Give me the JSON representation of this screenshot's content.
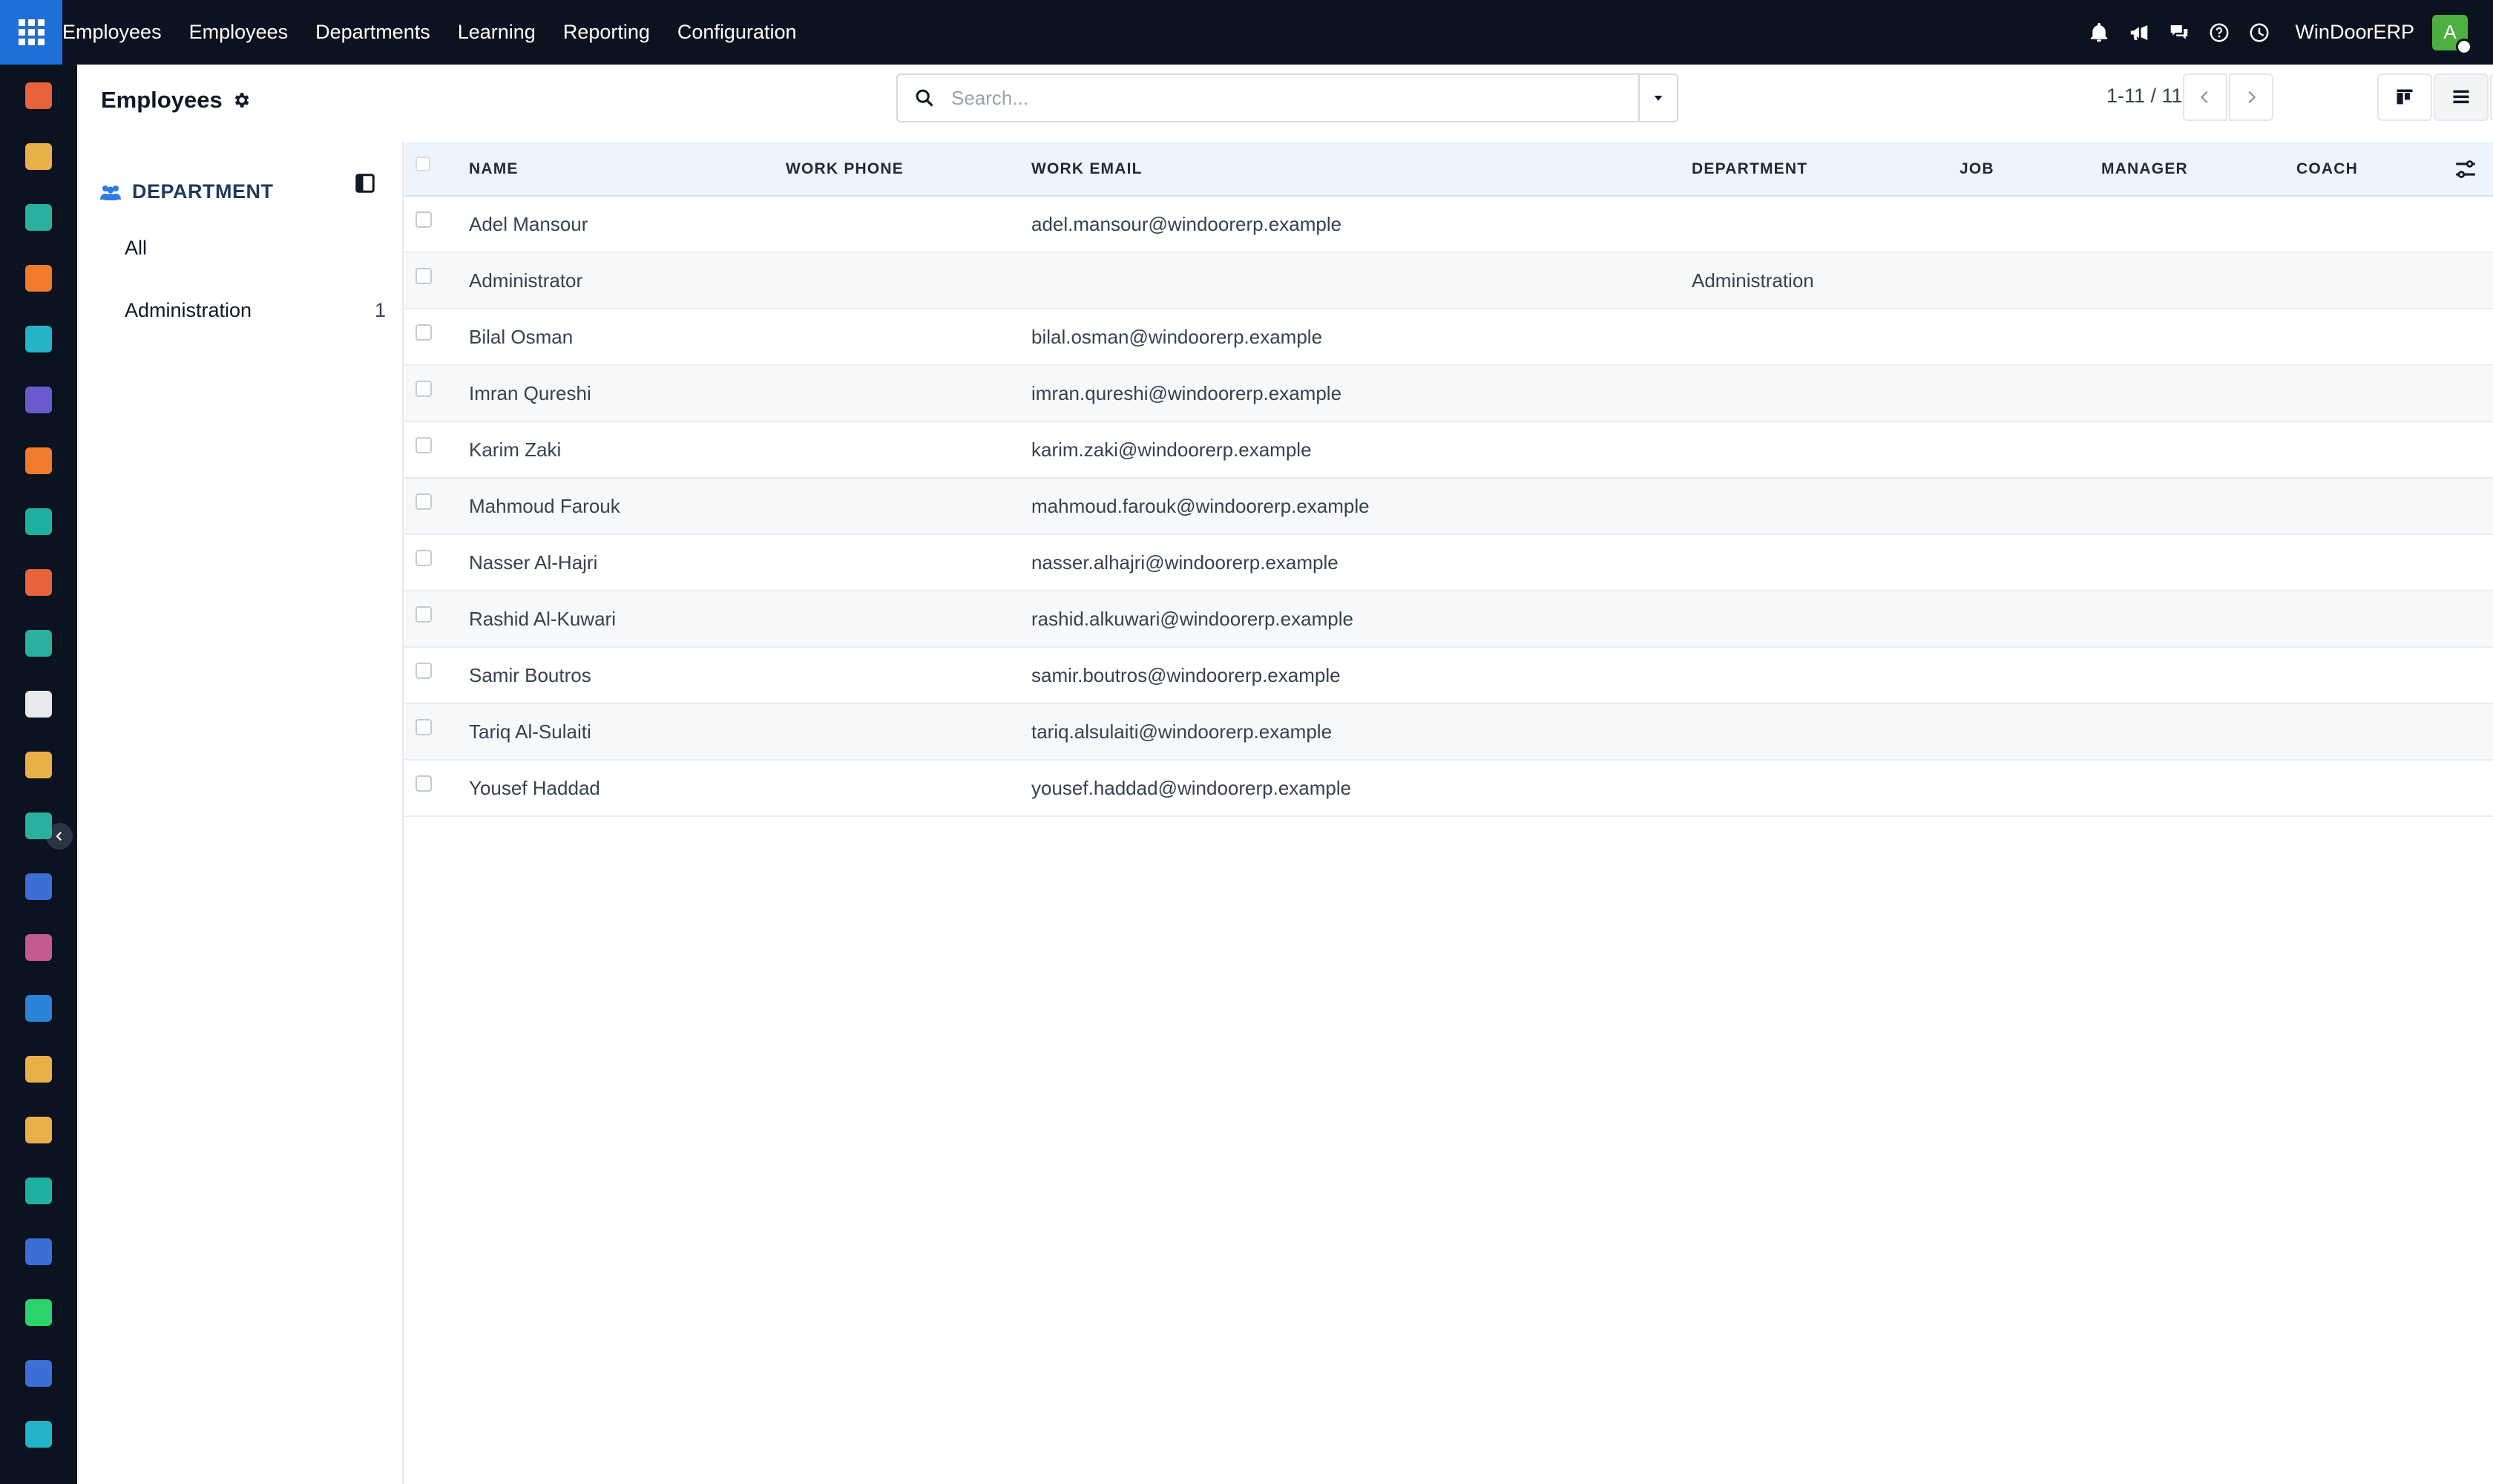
{
  "navbar": {
    "brand": "Employees",
    "menu": [
      "Employees",
      "Departments",
      "Learning",
      "Reporting",
      "Configuration"
    ],
    "company": "WinDoorERP",
    "avatar_letter": "A",
    "icons": [
      "bell-icon",
      "megaphone-icon",
      "chat-icon",
      "help-icon",
      "clock-icon"
    ]
  },
  "dock": {
    "apps": [
      {
        "name": "dashboards-app-icon",
        "color": "#e8623a"
      },
      {
        "name": "documents-app-icon",
        "color": "#e9b04a"
      },
      {
        "name": "contacts-app-icon",
        "color": "#2bb0a0"
      },
      {
        "name": "discuss-app-icon",
        "color": "#f07b2a"
      },
      {
        "name": "planning-app-icon",
        "color": "#22b5c8"
      },
      {
        "name": "mail-app-icon",
        "color": "#6a5acd"
      },
      {
        "name": "livechat-app-icon",
        "color": "#f07b2a"
      },
      {
        "name": "project-app-icon",
        "color": "#1fb1a0"
      },
      {
        "name": "reporting-app-icon",
        "color": "#e8623a"
      },
      {
        "name": "employees-app-icon",
        "color": "#2bb0a0"
      },
      {
        "name": "inventory-app-icon",
        "color": "#e7e9ee"
      },
      {
        "name": "sign-app-icon",
        "color": "#e9b04a"
      },
      {
        "name": "todo-app-icon",
        "color": "#2bb0a0"
      },
      {
        "name": "knowledge-app-icon",
        "color": "#3b6fd6"
      },
      {
        "name": "products-app-icon",
        "color": "#c45a8f"
      },
      {
        "name": "expenses-app-icon",
        "color": "#2b82d6"
      },
      {
        "name": "team-app-icon",
        "color": "#e9b04a"
      },
      {
        "name": "calendar-app-icon",
        "color": "#e9b04a"
      },
      {
        "name": "signature-app-icon",
        "color": "#1fb1a0"
      },
      {
        "name": "apps-dashboard-icon",
        "color": "#3b6fd6"
      },
      {
        "name": "whatsapp-app-icon",
        "color": "#2bd46b"
      },
      {
        "name": "timer-app-icon",
        "color": "#3b6fd6"
      },
      {
        "name": "website-app-icon",
        "color": "#22b5c8"
      }
    ]
  },
  "control": {
    "title": "Employees",
    "search_placeholder": "Search...",
    "pager": "1-11 / 11"
  },
  "searchpanel": {
    "header": "DEPARTMENT",
    "items": [
      {
        "label": "All",
        "count": ""
      },
      {
        "label": "Administration",
        "count": "1"
      }
    ]
  },
  "table": {
    "columns": [
      "NAME",
      "WORK PHONE",
      "WORK EMAIL",
      "DEPARTMENT",
      "JOB",
      "MANAGER",
      "COACH"
    ],
    "rows": [
      {
        "name": "Adel Mansour",
        "phone": "",
        "email": "adel.mansour@windoorerp.example",
        "department": ""
      },
      {
        "name": "Administrator",
        "phone": "",
        "email": "",
        "department": "Administration"
      },
      {
        "name": "Bilal Osman",
        "phone": "",
        "email": "bilal.osman@windoorerp.example",
        "department": ""
      },
      {
        "name": "Imran Qureshi",
        "phone": "",
        "email": "imran.qureshi@windoorerp.example",
        "department": ""
      },
      {
        "name": "Karim Zaki",
        "phone": "",
        "email": "karim.zaki@windoorerp.example",
        "department": ""
      },
      {
        "name": "Mahmoud Farouk",
        "phone": "",
        "email": "mahmoud.farouk@windoorerp.example",
        "department": ""
      },
      {
        "name": "Nasser Al-Hajri",
        "phone": "",
        "email": "nasser.alhajri@windoorerp.example",
        "department": ""
      },
      {
        "name": "Rashid Al-Kuwari",
        "phone": "",
        "email": "rashid.alkuwari@windoorerp.example",
        "department": ""
      },
      {
        "name": "Samir Boutros",
        "phone": "",
        "email": "samir.boutros@windoorerp.example",
        "department": ""
      },
      {
        "name": "Tariq Al-Sulaiti",
        "phone": "",
        "email": "tariq.alsulaiti@windoorerp.example",
        "department": ""
      },
      {
        "name": "Yousef Haddad",
        "phone": "",
        "email": "yousef.haddad@windoorerp.example",
        "department": ""
      }
    ]
  }
}
